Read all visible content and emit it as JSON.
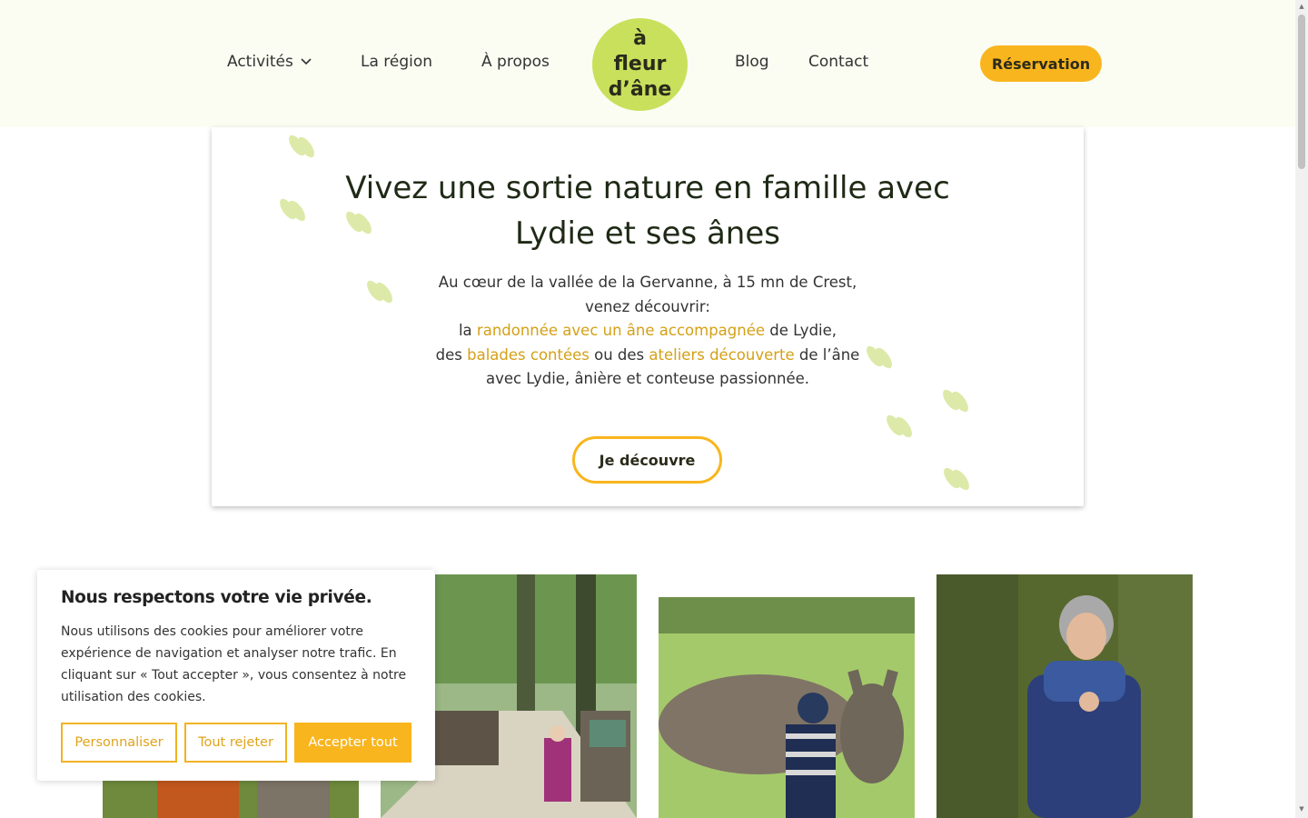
{
  "header": {
    "nav_left": [
      "Activités",
      "La région",
      "À propos"
    ],
    "nav_right": [
      "Blog",
      "Contact"
    ],
    "logo_lines": [
      "à",
      "fleur",
      "d’âne"
    ],
    "reservation_label": "Réservation",
    "chevron_icon": "chevron-down-icon"
  },
  "hero": {
    "title_line1": "Vivez une sortie nature en famille avec",
    "title_line2": "Lydie et ses ânes",
    "text": {
      "l1": "Au cœur de la vallée de la Gervanne, à 15 mn de Crest,",
      "l2": "venez découvrir:",
      "l3_a": "la ",
      "l3_link": "randonnée avec un âne accompagnée",
      "l3_b": " de Lydie,",
      "l4_a": "des ",
      "l4_link1": "balades contées",
      "l4_b": " ou des ",
      "l4_link2": "ateliers découverte",
      "l4_c": " de l’âne",
      "l5": "avec Lydie, ânière et conteuse passionnée."
    },
    "button_label": "Je découvre"
  },
  "cookie": {
    "title": "Nous respectons votre vie privée.",
    "text": "Nous utilisons des cookies pour améliorer votre expérience de navigation et analyser notre trafic. En cliquant sur « Tout accepter », vous consentez à notre utilisation des cookies.",
    "btn_customize": "Personnaliser",
    "btn_reject": "Tout rejeter",
    "btn_accept": "Accepter tout"
  },
  "colors": {
    "accent": "#f9b51d",
    "logo_green": "#c9e05c",
    "link": "#d4a017",
    "hoof": "#dde9a8"
  }
}
